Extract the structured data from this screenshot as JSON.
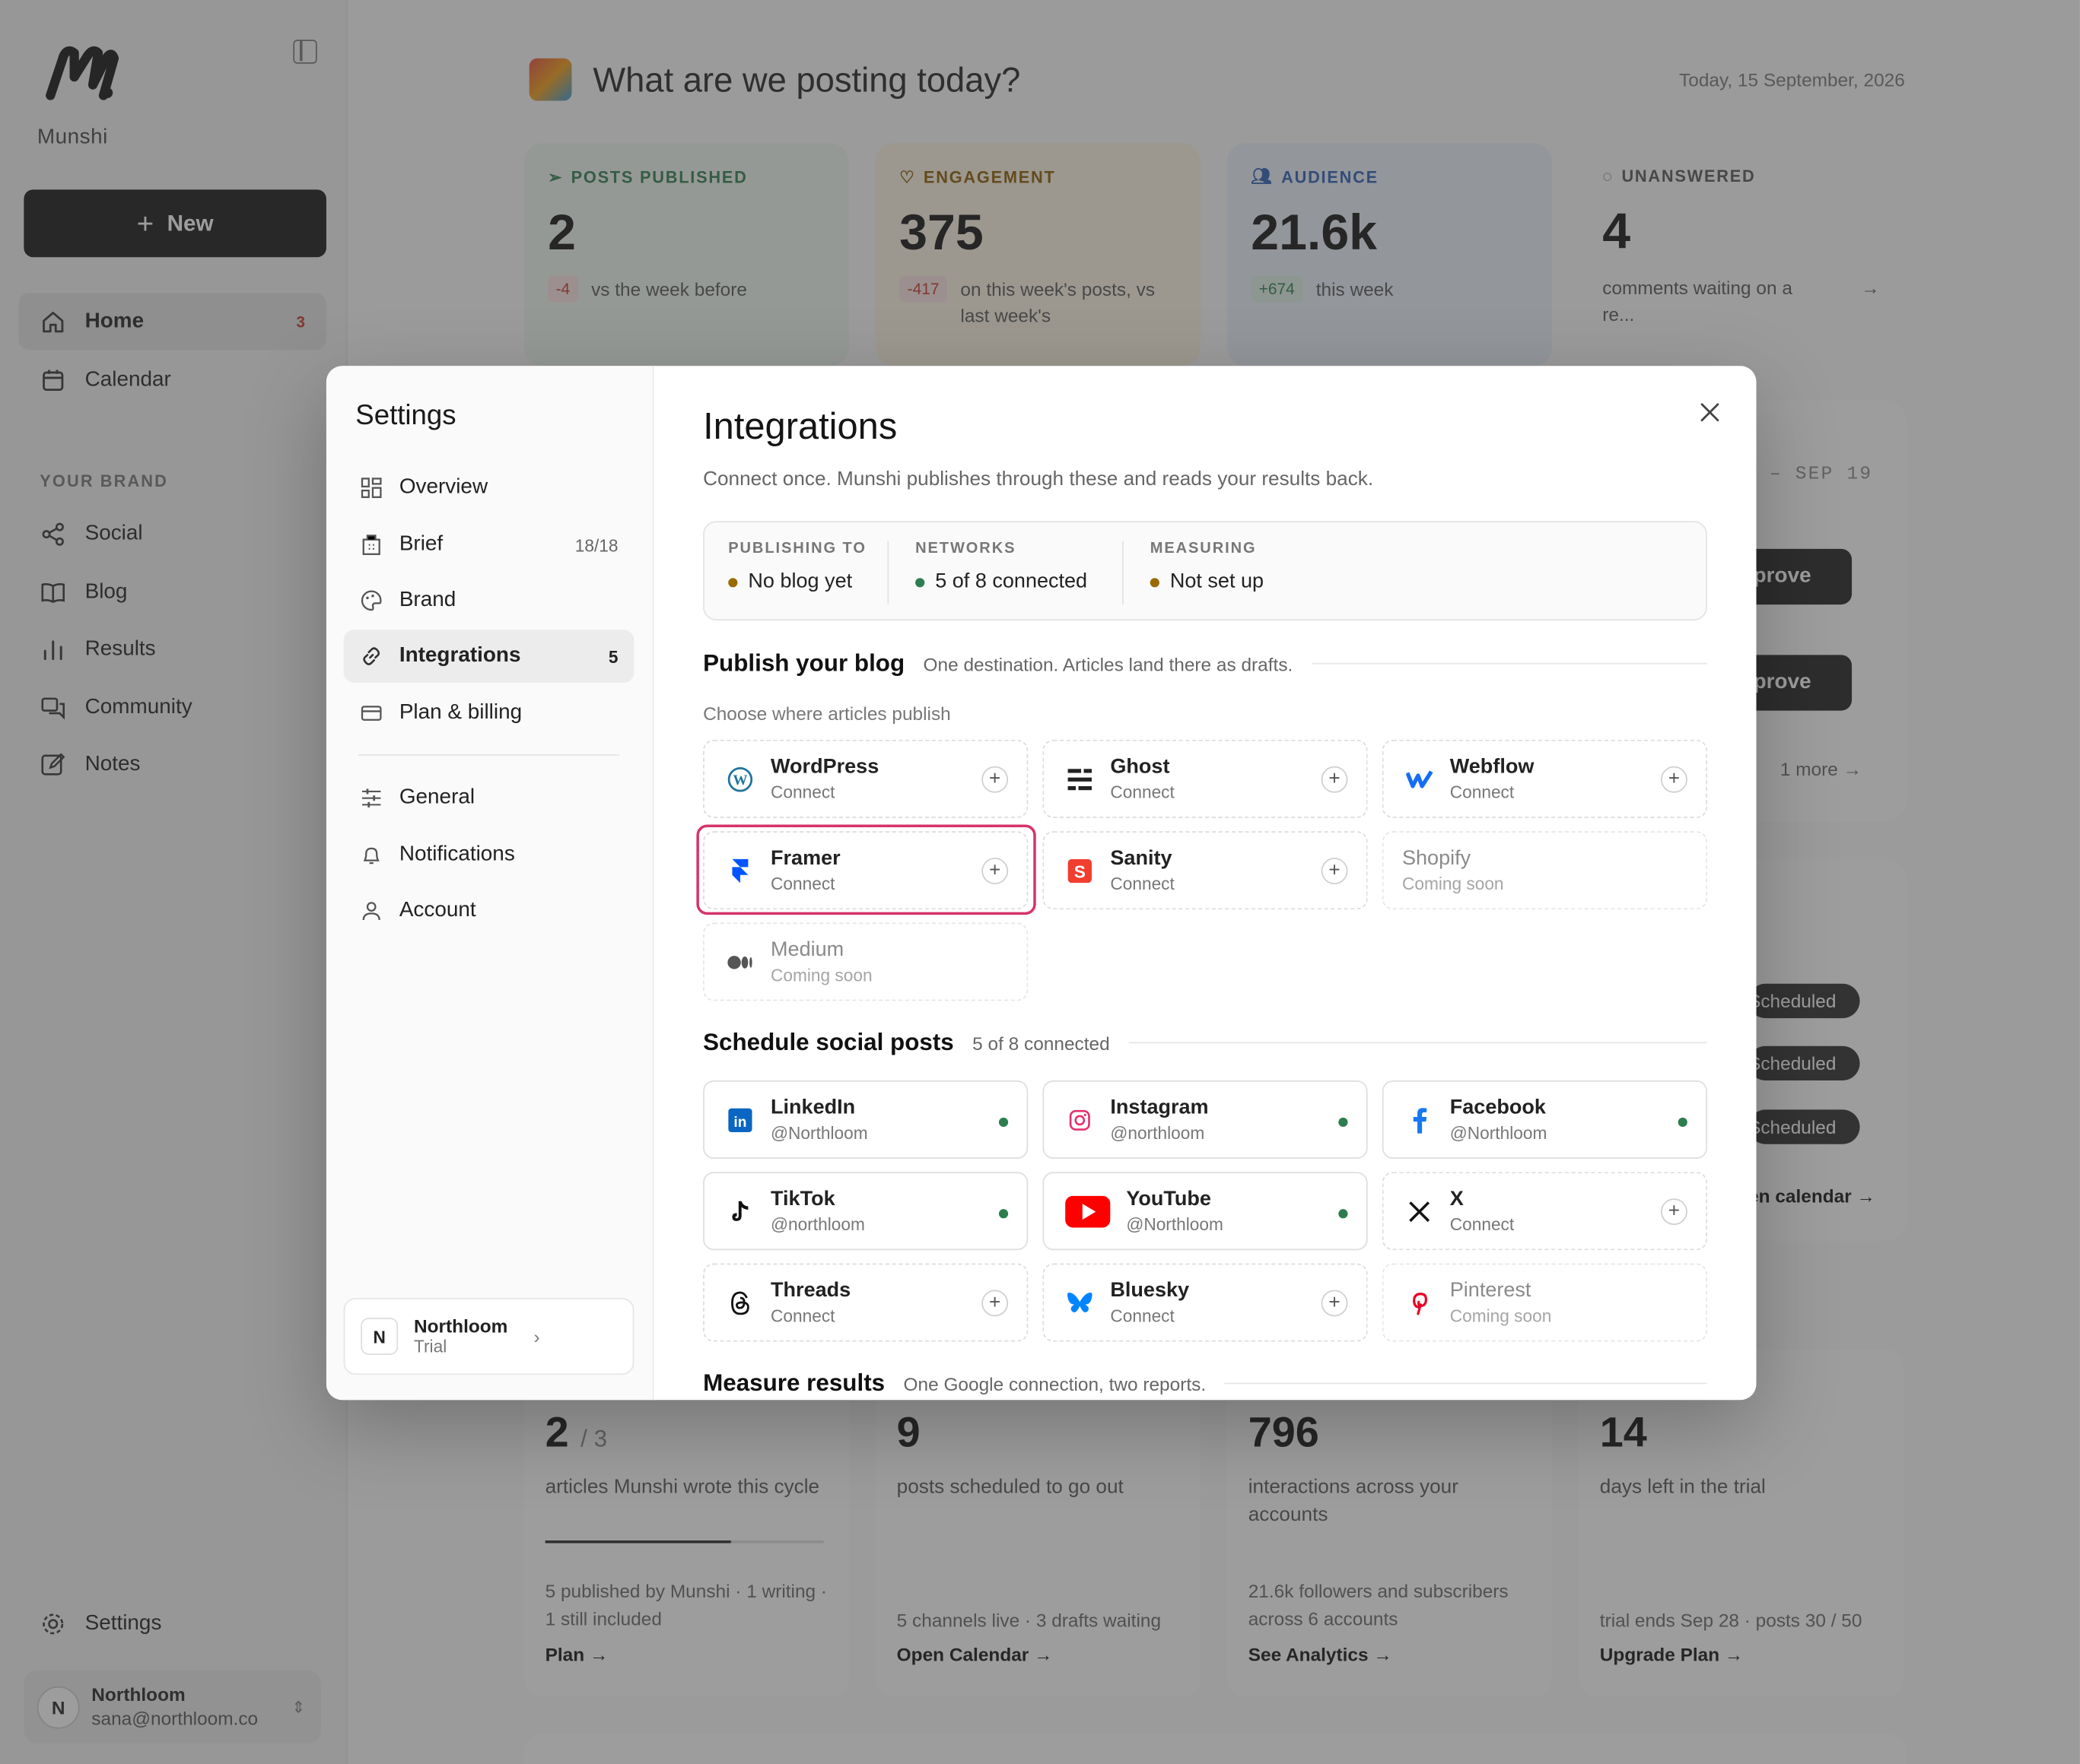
{
  "sidebar": {
    "brand": "Munshi",
    "new_label": "New",
    "nav": [
      {
        "label": "Home",
        "badge": "3",
        "icon": "home-icon"
      },
      {
        "label": "Calendar",
        "icon": "calendar-icon"
      }
    ],
    "section_label": "YOUR BRAND",
    "brand_nav": [
      {
        "label": "Social",
        "icon": "share-icon"
      },
      {
        "label": "Blog",
        "icon": "book-icon"
      },
      {
        "label": "Results",
        "icon": "bar-chart-icon"
      },
      {
        "label": "Community",
        "icon": "chat-icon"
      },
      {
        "label": "Notes",
        "icon": "edit-icon"
      }
    ],
    "settings_label": "Settings",
    "user": {
      "initial": "N",
      "name": "Northloom",
      "email": "sana@northloom.co"
    }
  },
  "main": {
    "title": "What are we posting today?",
    "date": "Today, 15 September, 2026",
    "stats": [
      {
        "label": "POSTS PUBLISHED",
        "value": "2",
        "delta": "-4",
        "desc": "vs the week before",
        "color": "#2e7d4f"
      },
      {
        "label": "ENGAGEMENT",
        "value": "375",
        "delta": "-417",
        "desc": "on this week's posts, vs last week's",
        "color": "#8a5a00"
      },
      {
        "label": "AUDIENCE",
        "value": "21.6k",
        "delta": "+674",
        "desc": "this week",
        "color": "#2b5fb5"
      },
      {
        "label": "UNANSWERED",
        "value": "4",
        "desc": "comments waiting on a re...",
        "color": "#555555"
      }
    ],
    "right_panel": {
      "date_range": "– SEP 19",
      "approve": [
        "pprove",
        "pprove"
      ],
      "more": "1 more",
      "scheduled": [
        "Scheduled",
        "Scheduled",
        "Scheduled"
      ],
      "calendar_link": "en calendar →"
    },
    "bottom_cards": [
      {
        "value": "2",
        "value_suffix": "/ 3",
        "text": "articles Munshi wrote this cycle",
        "progress": 0.667,
        "small": "5 published by Munshi · 1 writing · 1 still included",
        "link": "Plan →"
      },
      {
        "value": "9",
        "text": "posts scheduled to go out",
        "small": "5 channels live · 3 drafts waiting",
        "link": "Open Calendar →"
      },
      {
        "value": "796",
        "text": "interactions across your accounts",
        "small": "21.6k followers and subscribers across 6 accounts",
        "link": "See Analytics →"
      },
      {
        "value": "14",
        "text": "days left in the trial",
        "small": "trial ends Sep 28 · posts 30 / 50",
        "link": "Upgrade Plan →"
      }
    ]
  },
  "modal": {
    "settings_title": "Settings",
    "menu": [
      {
        "label": "Overview",
        "icon": "grid-icon"
      },
      {
        "label": "Brief",
        "count": "18/18",
        "icon": "building-icon"
      },
      {
        "label": "Brand",
        "icon": "palette-icon"
      },
      {
        "label": "Integrations",
        "count": "5",
        "icon": "link-icon",
        "active": true
      },
      {
        "label": "Plan & billing",
        "icon": "card-icon"
      }
    ],
    "menu2": [
      {
        "label": "General",
        "icon": "sliders-icon"
      },
      {
        "label": "Notifications",
        "icon": "bell-icon"
      },
      {
        "label": "Account",
        "icon": "user-icon"
      }
    ],
    "org": {
      "initial": "N",
      "name": "Northloom",
      "plan": "Trial"
    },
    "title": "Integrations",
    "subtitle": "Connect once. Munshi publishes through these and reads your results back.",
    "summary": [
      {
        "label": "PUBLISHING TO",
        "value": "No blog yet",
        "dot": "#9a6a00"
      },
      {
        "label": "NETWORKS",
        "value": "5 of 8 connected",
        "dot": "#2e7d4f"
      },
      {
        "label": "MEASURING",
        "value": "Not set up",
        "dot": "#9a6a00"
      }
    ],
    "blog": {
      "title": "Publish your blog",
      "subtitle": "One destination. Articles land there as drafts.",
      "choose": "Choose where articles publish",
      "items": [
        {
          "name": "WordPress",
          "status": "Connect"
        },
        {
          "name": "Ghost",
          "status": "Connect"
        },
        {
          "name": "Webflow",
          "status": "Connect"
        },
        {
          "name": "Framer",
          "status": "Connect"
        },
        {
          "name": "Sanity",
          "status": "Connect"
        },
        {
          "name": "Shopify",
          "status": "Coming soon"
        },
        {
          "name": "Medium",
          "status": "Coming soon"
        }
      ]
    },
    "social": {
      "title": "Schedule social posts",
      "subtitle": "5 of 8 connected",
      "items": [
        {
          "name": "LinkedIn",
          "status": "@Northloom"
        },
        {
          "name": "Instagram",
          "status": "@northloom"
        },
        {
          "name": "Facebook",
          "status": "@Northloom"
        },
        {
          "name": "TikTok",
          "status": "@northloom"
        },
        {
          "name": "YouTube",
          "status": "@Northloom"
        },
        {
          "name": "X",
          "status": "Connect"
        },
        {
          "name": "Threads",
          "status": "Connect"
        },
        {
          "name": "Bluesky",
          "status": "Connect"
        },
        {
          "name": "Pinterest",
          "status": "Coming soon"
        }
      ]
    },
    "measure": {
      "title": "Measure results",
      "subtitle": "One Google connection, two reports."
    }
  }
}
